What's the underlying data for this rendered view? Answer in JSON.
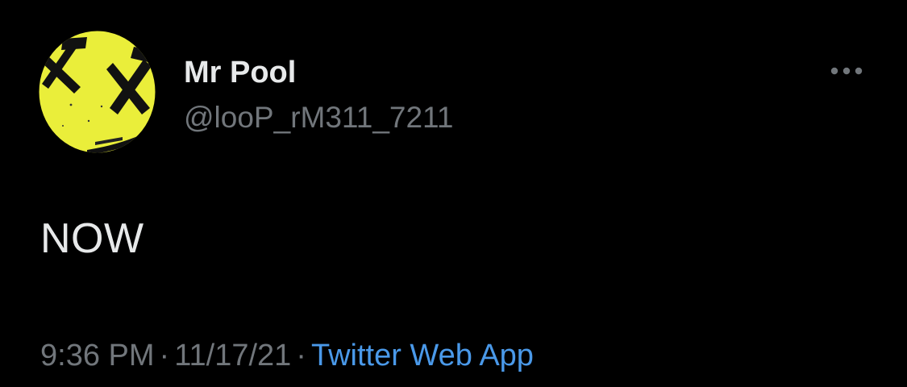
{
  "tweet": {
    "author": {
      "display_name": "Mr Pool",
      "handle": "@looP_rM311_7211",
      "avatar_icon": "yellow-smiley-x-eyes-avatar",
      "avatar_color": "#eef03c"
    },
    "more_icon": "ellipsis-horizontal-icon",
    "text": "NOW",
    "time": "9:36 PM",
    "separator": "·",
    "date": "11/17/21",
    "source": "Twitter Web App"
  },
  "colors": {
    "background": "#000000",
    "primary_text": "#e7e9ea",
    "secondary_text": "#71767b",
    "link": "#4a99e9"
  }
}
